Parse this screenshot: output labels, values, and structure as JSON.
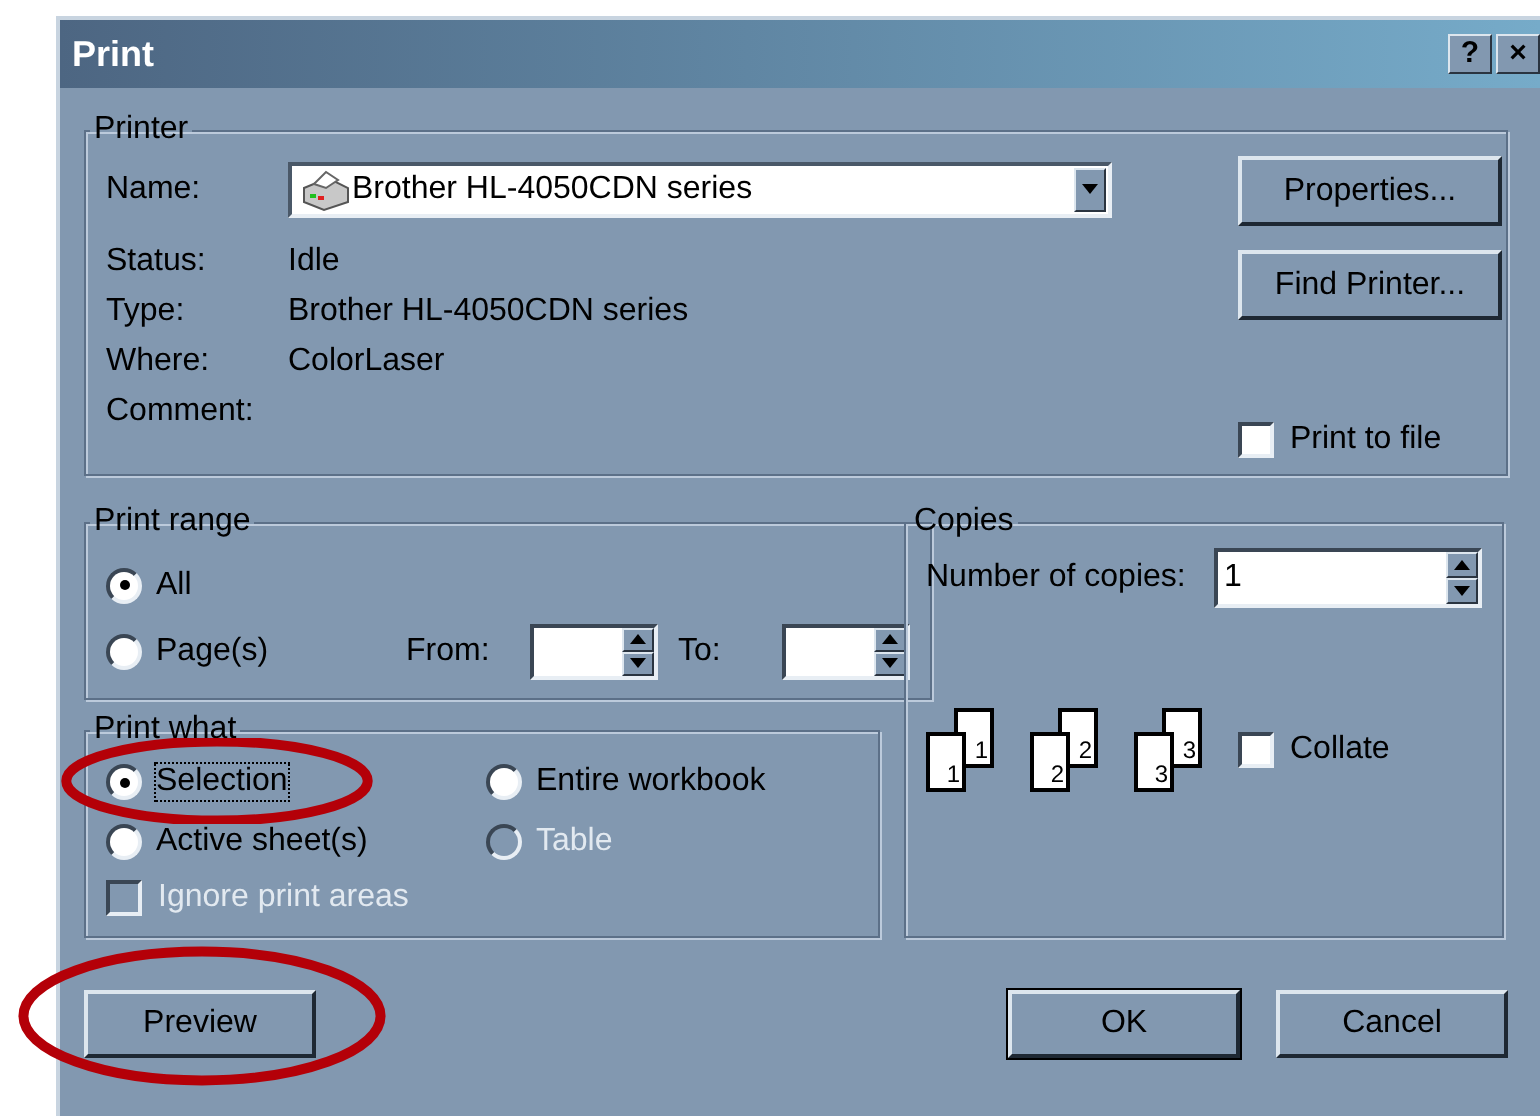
{
  "window": {
    "title": "Print",
    "title_buttons": [
      "?",
      "×"
    ]
  },
  "printer": {
    "title": "Printer",
    "name_label": "Name:",
    "name_value": "Brother HL-4050CDN series",
    "details": [
      {
        "label": "Status:",
        "value": "Idle"
      },
      {
        "label": "Type:",
        "value": "Brother HL-4050CDN series"
      },
      {
        "label": "Where:",
        "value": "ColorLaser"
      },
      {
        "label": "Comment:"
      }
    ],
    "buttons": [
      "Properties...",
      "Find Printer..."
    ],
    "print_to_file": {
      "label": "Print to file",
      "checked": false
    }
  },
  "print_range": {
    "title": "Print range",
    "options": [
      {
        "label": "All",
        "selected": true
      },
      {
        "label": "Page(s)",
        "selected": false
      }
    ],
    "from_label": "From:",
    "to_label": "To:"
  },
  "print_what": {
    "title": "Print what",
    "options": [
      {
        "label": "Selection",
        "selected": true,
        "disabled": false,
        "focused": true,
        "circled": true
      },
      {
        "label": "Entire workbook",
        "selected": false,
        "disabled": false,
        "focused": false,
        "circled": false
      },
      {
        "label": "Active sheet(s)",
        "selected": false,
        "disabled": false,
        "focused": false,
        "circled": false
      },
      {
        "label": "Table",
        "selected": false,
        "disabled": true,
        "focused": false,
        "circled": false
      }
    ],
    "ignore_print_areas": {
      "label": "Ignore print areas",
      "checked": false,
      "disabled": true
    }
  },
  "copies": {
    "title": "Copies",
    "number_label": "Number of copies:",
    "number_value": "1",
    "stacks": [
      [
        "1",
        "1"
      ],
      [
        "2",
        "2"
      ],
      [
        "3",
        "3"
      ]
    ],
    "collate": {
      "label": "Collate",
      "checked": false
    }
  },
  "buttons": [
    {
      "label": "Preview",
      "default": false,
      "circled": true
    },
    {
      "label": "OK",
      "default": true,
      "circled": false
    },
    {
      "label": "Cancel",
      "default": false,
      "circled": false
    }
  ]
}
